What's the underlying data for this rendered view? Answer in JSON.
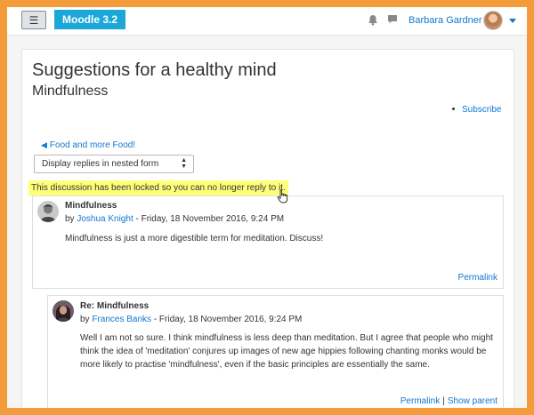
{
  "navbar": {
    "brand": "Moodle 3.2",
    "menu_icon": "hamburger-icon",
    "notifications_icon": "bell-icon",
    "messages_icon": "speech-bubble-icon",
    "user_name": "Barbara Gardner"
  },
  "page": {
    "title": "Suggestions for a healthy mind",
    "subtitle": "Mindfulness",
    "subscribe": "Subscribe",
    "back_link": "Food and more Food!",
    "display_mode": "Display replies in nested form",
    "locked_notice": "This discussion has been locked so you can no longer reply to it."
  },
  "posts": [
    {
      "subject": "Mindfulness",
      "by": "by ",
      "author": "Joshua Knight",
      "date": " - Friday, 18 November 2016, 9:24 PM",
      "message": "Mindfulness is just a more digestible term for meditation. Discuss!",
      "permalink": "Permalink"
    },
    {
      "subject": "Re: Mindfulness",
      "by": "by ",
      "author": "Frances Banks",
      "date": " - Friday, 18 November 2016, 9:24 PM",
      "message": "Well I am  not so sure. I think mindfulness is less deep than meditation. But I agree that people who might think the idea of 'meditation' conjures up images of new age hippies following chanting monks would be more likely to practise 'mindfulness', even if the basic principles are essentially the same.",
      "permalink": "Permalink",
      "separator": "|",
      "show_parent": "Show parent"
    }
  ],
  "colors": {
    "frame_border": "#f49b3b",
    "brand_bg": "#1ba7d8",
    "link": "#1177d1",
    "locked_highlight": "#ffff7a"
  }
}
